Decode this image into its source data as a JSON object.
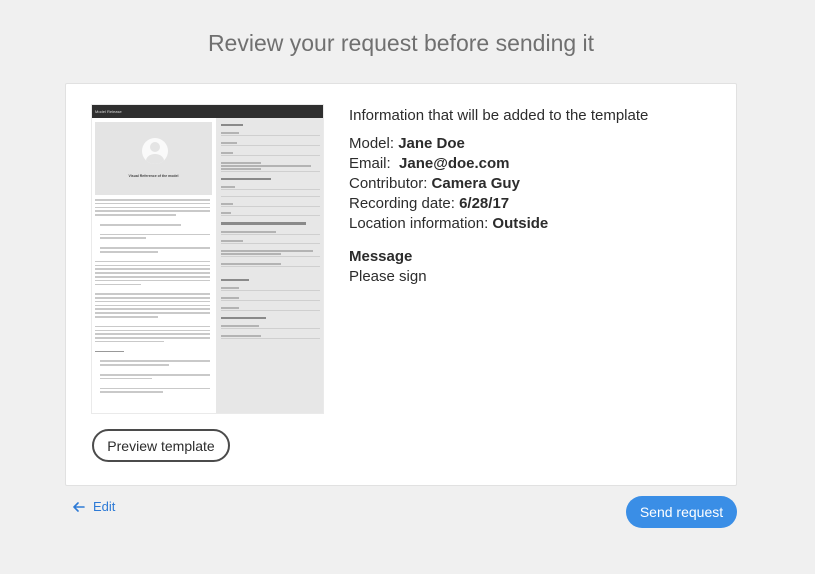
{
  "page": {
    "title": "Review your request before sending it"
  },
  "template_preview": {
    "header": "Model Release",
    "photo_caption": "Visual Reference of the model"
  },
  "info": {
    "heading": "Information that will be added to the template",
    "fields": [
      {
        "label": "Model: ",
        "value": "Jane Doe"
      },
      {
        "label": "Email:  ",
        "value": "Jane@doe.com"
      },
      {
        "label": "Contributor: ",
        "value": "Camera Guy"
      },
      {
        "label": "Recording date: ",
        "value": "6/28/17"
      },
      {
        "label": "Location information: ",
        "value": "Outside"
      }
    ],
    "message_heading": "Message",
    "message_body": "Please sign"
  },
  "buttons": {
    "preview_template": "Preview template",
    "edit": "Edit",
    "send_request": "Send request"
  },
  "colors": {
    "accent": "#3a8ee6",
    "link": "#2d7ad6",
    "background": "#f0f0f0"
  },
  "icons": {
    "edit": "arrow-left-icon"
  }
}
